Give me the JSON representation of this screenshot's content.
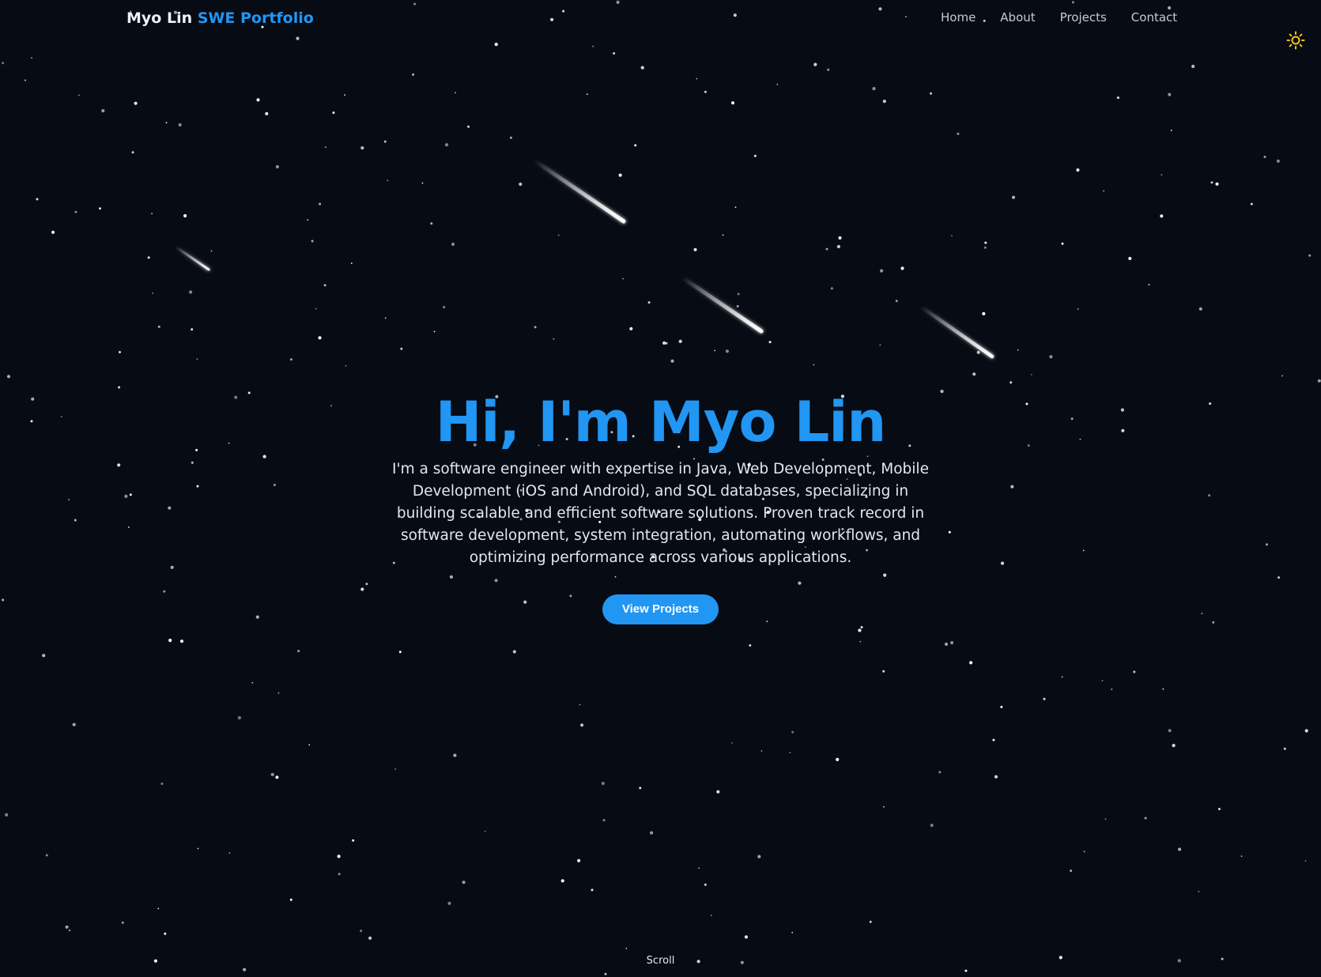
{
  "nav": {
    "brand_name": "Myo Lin",
    "brand_accent": "SWE Portfolio",
    "links": [
      "Home",
      "About",
      "Projects",
      "Contact"
    ]
  },
  "theme_toggle": {
    "icon": "sun-icon"
  },
  "hero": {
    "title": "Hi, I'm Myo Lin",
    "description": "I'm a software engineer with expertise in Java, Web Development, Mobile Development (iOS and Android), and SQL databases, specializing in building scalable and efficient software solutions. Proven track record in software development, system integration, automating workflows, and optimizing performance across various applications.",
    "cta_label": "View Projects"
  },
  "scroll_label": "Scroll",
  "colors": {
    "background": "#070b14",
    "accent": "#2196f3",
    "text": "#e3e7ee",
    "sun": "#f5c518"
  }
}
